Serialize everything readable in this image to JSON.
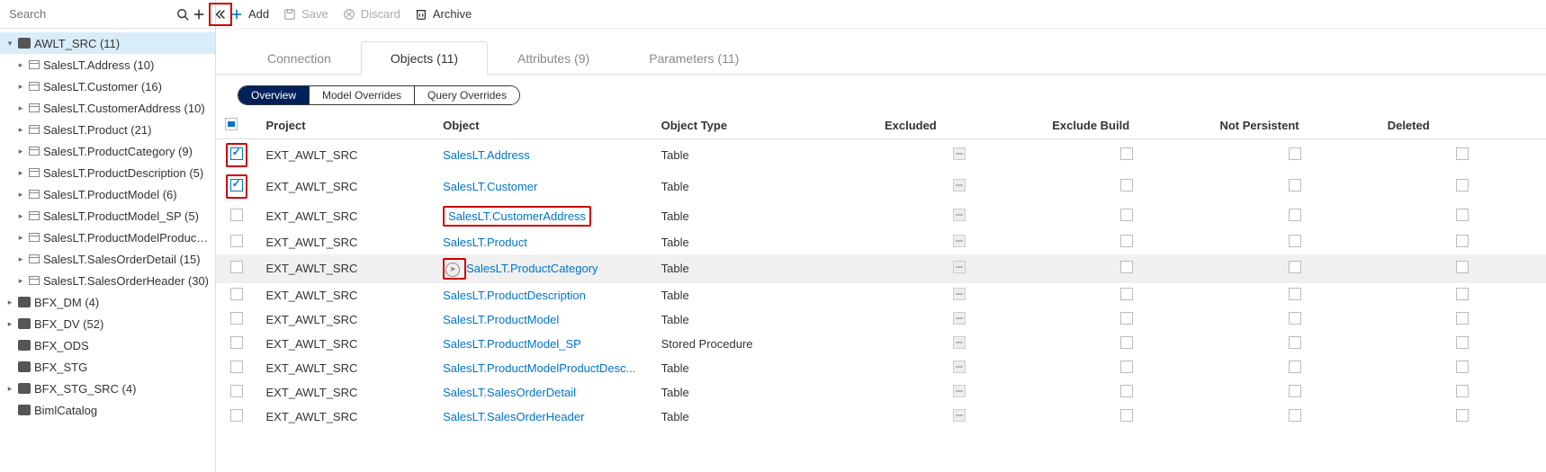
{
  "search": {
    "placeholder": "Search"
  },
  "toolbar": {
    "add": "Add",
    "save": "Save",
    "discard": "Discard",
    "archive": "Archive"
  },
  "tabs": {
    "connection": "Connection",
    "objects": "Objects (11)",
    "attributes": "Attributes (9)",
    "parameters": "Parameters (11)"
  },
  "subtabs": {
    "overview": "Overview",
    "model": "Model Overrides",
    "query": "Query Overrides"
  },
  "headers": {
    "project": "Project",
    "object": "Object",
    "objectType": "Object Type",
    "excluded": "Excluded",
    "excludeBuild": "Exclude Build",
    "notPersistent": "Not Persistent",
    "deleted": "Deleted"
  },
  "tree": {
    "root": "AWLT_SRC (11)",
    "children": [
      "SalesLT.Address (10)",
      "SalesLT.Customer (16)",
      "SalesLT.CustomerAddress (10)",
      "SalesLT.Product (21)",
      "SalesLT.ProductCategory (9)",
      "SalesLT.ProductDescription (5)",
      "SalesLT.ProductModel (6)",
      "SalesLT.ProductModel_SP (5)",
      "SalesLT.ProductModelProductDescripti...",
      "SalesLT.SalesOrderDetail (15)",
      "SalesLT.SalesOrderHeader (30)"
    ],
    "others": [
      "BFX_DM (4)",
      "BFX_DV (52)",
      "BFX_ODS",
      "BFX_STG",
      "BFX_STG_SRC (4)",
      "BimlCatalog"
    ]
  },
  "rows": [
    {
      "project": "EXT_AWLT_SRC",
      "object": "SalesLT.Address",
      "type": "Table",
      "checked": true,
      "redCheck": true
    },
    {
      "project": "EXT_AWLT_SRC",
      "object": "SalesLT.Customer",
      "type": "Table",
      "checked": true,
      "redCheck": true
    },
    {
      "project": "EXT_AWLT_SRC",
      "object": "SalesLT.CustomerAddress",
      "type": "Table",
      "redObj": true
    },
    {
      "project": "EXT_AWLT_SRC",
      "object": "SalesLT.Product",
      "type": "Table"
    },
    {
      "project": "EXT_AWLT_SRC",
      "object": "SalesLT.ProductCategory",
      "type": "Table",
      "navIcon": true,
      "redNav": true,
      "hovered": true
    },
    {
      "project": "EXT_AWLT_SRC",
      "object": "SalesLT.ProductDescription",
      "type": "Table"
    },
    {
      "project": "EXT_AWLT_SRC",
      "object": "SalesLT.ProductModel",
      "type": "Table"
    },
    {
      "project": "EXT_AWLT_SRC",
      "object": "SalesLT.ProductModel_SP",
      "type": "Stored Procedure"
    },
    {
      "project": "EXT_AWLT_SRC",
      "object": "SalesLT.ProductModelProductDesc...",
      "type": "Table"
    },
    {
      "project": "EXT_AWLT_SRC",
      "object": "SalesLT.SalesOrderDetail",
      "type": "Table"
    },
    {
      "project": "EXT_AWLT_SRC",
      "object": "SalesLT.SalesOrderHeader",
      "type": "Table"
    }
  ]
}
